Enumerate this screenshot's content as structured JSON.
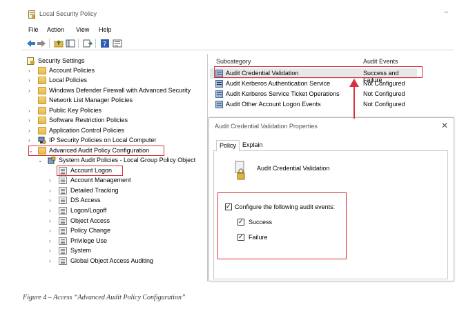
{
  "window": {
    "title": "Local Security Policy",
    "minimize_glyph": "–"
  },
  "menu": [
    "File",
    "Action",
    "View",
    "Help"
  ],
  "toolbar_icons": [
    "back-arrow-icon",
    "forward-arrow-icon",
    "up-folder-icon",
    "show-hide-tree-icon",
    "export-list-icon",
    "help-icon",
    "properties-icon"
  ],
  "tree": {
    "root": "Security Settings",
    "items": [
      {
        "label": "Account Policies",
        "expandable": true
      },
      {
        "label": "Local Policies",
        "expandable": true
      },
      {
        "label": "Windows Defender Firewall with Advanced Security",
        "expandable": true
      },
      {
        "label": "Network List Manager Policies",
        "expandable": false
      },
      {
        "label": "Public Key Policies",
        "expandable": true
      },
      {
        "label": "Software Restriction Policies",
        "expandable": true
      },
      {
        "label": "Application Control Policies",
        "expandable": true
      },
      {
        "label": "IP Security Policies on Local Computer",
        "expandable": true
      },
      {
        "label": "Advanced Audit Policy Configuration",
        "expandable": true,
        "expanded": true
      }
    ],
    "sub_root": "System Audit Policies - Local Group Policy Object",
    "sub_items": [
      {
        "label": "Account Logon",
        "selected": true
      },
      {
        "label": "Account Management"
      },
      {
        "label": "Detailed Tracking"
      },
      {
        "label": "DS Access"
      },
      {
        "label": "Logon/Logoff"
      },
      {
        "label": "Object Access"
      },
      {
        "label": "Policy Change"
      },
      {
        "label": "Privilege Use"
      },
      {
        "label": "System"
      },
      {
        "label": "Global Object Access Auditing"
      }
    ]
  },
  "list": {
    "headers": [
      "Subcategory",
      "Audit Events"
    ],
    "rows": [
      {
        "subcategory": "Audit Credential Validation",
        "events": "Success and Failure"
      },
      {
        "subcategory": "Audit Kerberos Authentication Service",
        "events": "Not Configured"
      },
      {
        "subcategory": "Audit Kerberos Service Ticket Operations",
        "events": "Not Configured"
      },
      {
        "subcategory": "Audit Other Account Logon Events",
        "events": "Not Configured"
      }
    ]
  },
  "dialog": {
    "title": "Audit Credential Validation Properties",
    "close_glyph": "✕",
    "tabs": [
      "Policy",
      "Explain"
    ],
    "policy_name": "Audit Credential Validation",
    "configure_label": "Configure the following audit events:",
    "success_label": "Success",
    "failure_label": "Failure"
  },
  "caption": "Figure 4 – Access “Advanced Audit Policy Configuration”",
  "colors": {
    "highlight": "#d9303d",
    "folder": "#e7b84a"
  }
}
